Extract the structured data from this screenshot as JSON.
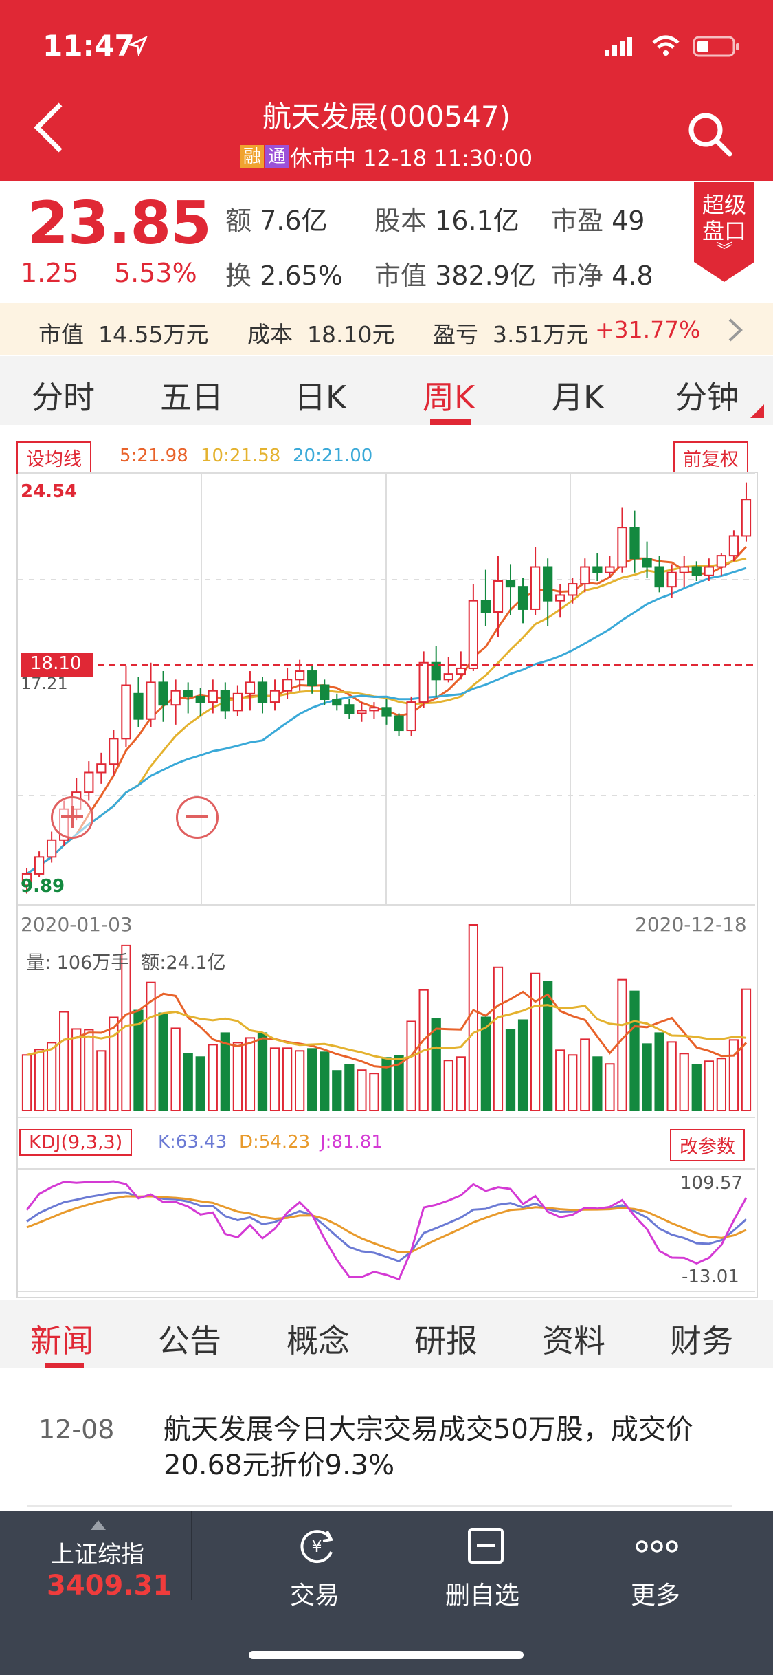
{
  "status": {
    "time": "11:47"
  },
  "header": {
    "title": "航天发展(000547)",
    "tag_rong": "融",
    "tag_tong": "通",
    "status_text": "休市中 12-18 11:30:00"
  },
  "quote": {
    "price": "23.85",
    "change": "1.25",
    "change_pct": "5.53%",
    "items": [
      {
        "k": "额",
        "v": "7.6亿"
      },
      {
        "k": "股本",
        "v": "16.1亿"
      },
      {
        "k": "市盈",
        "v": "49"
      },
      {
        "k": "换",
        "v": "2.65%"
      },
      {
        "k": "市值",
        "v": "382.9亿"
      },
      {
        "k": "市净",
        "v": "4.8"
      }
    ],
    "badge": "超级盘口"
  },
  "holdings": {
    "mv_label": "市值",
    "mv": "14.55万元",
    "cost_label": "成本",
    "cost": "18.10元",
    "pl_label": "盈亏",
    "pl": "3.51万元",
    "pl_pct": "+31.77%"
  },
  "period_tabs": [
    "分时",
    "五日",
    "日K",
    "周K",
    "月K",
    "分钟"
  ],
  "active_period": 3,
  "chart": {
    "ma_button": "设均线",
    "adj_button": "前复权",
    "ma5": "5:21.98",
    "ma10": "10:21.58",
    "ma20": "20:21.00",
    "high_label": "24.54",
    "low_label": "9.89",
    "cost_line_label": "18.10",
    "ref_label": "17.21",
    "date_start": "2020-01-03",
    "date_end": "2020-12-18",
    "vol_label": "量: 106万手",
    "amt_label": "额:24.1亿",
    "kdj_button": "KDJ(9,3,3)",
    "kdj_k": "K:63.43",
    "kdj_d": "D:54.23",
    "kdj_j": "J:81.81",
    "kdj_param_button": "改参数",
    "kdj_max": "109.57",
    "kdj_min": "-13.01",
    "colors": {
      "up": "#e02835",
      "down": "#13893f",
      "ma5": "#e8622a",
      "ma10": "#e4b22f",
      "ma20": "#3aa9d8",
      "k": "#6b7ad4",
      "d": "#e89a2c",
      "j": "#d43ad4"
    }
  },
  "chart_data": {
    "type": "candlestick",
    "price_range": [
      9.89,
      24.54
    ],
    "candles": [
      [
        10.2,
        10.6,
        9.9,
        10.8
      ],
      [
        10.6,
        11.2,
        10.5,
        11.4
      ],
      [
        11.2,
        11.8,
        11.0,
        12.1
      ],
      [
        11.8,
        12.9,
        11.6,
        13.2
      ],
      [
        12.9,
        13.5,
        12.5,
        14.0
      ],
      [
        13.5,
        14.2,
        13.2,
        14.6
      ],
      [
        14.2,
        14.5,
        13.8,
        14.9
      ],
      [
        14.5,
        15.4,
        14.1,
        15.7
      ],
      [
        15.4,
        17.3,
        15.1,
        18.0
      ],
      [
        17.0,
        16.1,
        15.8,
        17.6
      ],
      [
        16.1,
        17.4,
        15.8,
        18.1
      ],
      [
        17.4,
        16.6,
        16.0,
        17.8
      ],
      [
        16.6,
        17.1,
        15.9,
        17.5
      ],
      [
        17.1,
        16.9,
        16.3,
        17.4
      ],
      [
        16.9,
        16.7,
        16.2,
        17.2
      ],
      [
        16.7,
        17.1,
        16.3,
        17.5
      ],
      [
        17.1,
        16.4,
        16.1,
        17.4
      ],
      [
        16.4,
        17.0,
        16.2,
        17.3
      ],
      [
        17.0,
        17.4,
        16.4,
        17.8
      ],
      [
        17.4,
        16.7,
        16.3,
        17.6
      ],
      [
        16.7,
        17.1,
        16.4,
        17.5
      ],
      [
        17.1,
        17.5,
        16.8,
        17.9
      ],
      [
        17.5,
        17.8,
        17.1,
        18.2
      ],
      [
        17.8,
        17.3,
        17.0,
        18.0
      ],
      [
        17.3,
        16.8,
        16.6,
        17.5
      ],
      [
        16.8,
        16.6,
        16.4,
        17.0
      ],
      [
        16.6,
        16.3,
        16.1,
        16.8
      ],
      [
        16.3,
        16.4,
        16.0,
        16.7
      ],
      [
        16.4,
        16.5,
        16.1,
        16.7
      ],
      [
        16.5,
        16.2,
        15.9,
        16.8
      ],
      [
        16.2,
        15.7,
        15.5,
        16.3
      ],
      [
        15.7,
        16.7,
        15.5,
        16.9
      ],
      [
        16.7,
        18.1,
        16.5,
        18.5
      ],
      [
        18.1,
        17.5,
        16.9,
        18.7
      ],
      [
        17.5,
        17.7,
        17.4,
        18.3
      ],
      [
        17.7,
        17.9,
        17.5,
        18.5
      ],
      [
        17.9,
        20.3,
        17.8,
        20.9
      ],
      [
        20.3,
        19.9,
        19.4,
        21.4
      ],
      [
        19.9,
        21.0,
        19.0,
        21.9
      ],
      [
        21.0,
        20.8,
        19.8,
        21.6
      ],
      [
        20.8,
        20.0,
        19.5,
        21.1
      ],
      [
        20.0,
        21.5,
        19.8,
        22.2
      ],
      [
        21.5,
        20.3,
        19.4,
        21.8
      ],
      [
        20.3,
        20.5,
        19.7,
        20.9
      ],
      [
        20.5,
        20.9,
        20.2,
        21.1
      ],
      [
        20.9,
        21.5,
        20.6,
        21.8
      ],
      [
        21.5,
        21.3,
        21.0,
        22.0
      ],
      [
        21.3,
        21.5,
        21.1,
        21.9
      ],
      [
        21.5,
        22.9,
        21.3,
        23.6
      ],
      [
        22.9,
        21.8,
        21.3,
        23.5
      ],
      [
        21.8,
        21.5,
        21.1,
        22.4
      ],
      [
        21.5,
        20.8,
        20.6,
        21.9
      ],
      [
        20.8,
        21.3,
        20.4,
        21.6
      ],
      [
        21.3,
        21.5,
        20.8,
        21.9
      ],
      [
        21.5,
        21.2,
        21.0,
        21.7
      ],
      [
        21.2,
        21.5,
        21.0,
        21.8
      ],
      [
        21.5,
        21.9,
        21.2,
        22.0
      ],
      [
        21.9,
        22.6,
        21.7,
        22.8
      ],
      [
        22.6,
        23.9,
        22.4,
        24.5
      ]
    ]
  },
  "news_tabs": [
    "新闻",
    "公告",
    "概念",
    "研报",
    "资料",
    "财务"
  ],
  "active_news": 0,
  "news": [
    {
      "date": "12-08",
      "text": "航天发展今日大宗交易成交50万股，成交价20.68元折价9.3%"
    }
  ],
  "bottom": {
    "index_name": "上证综指",
    "index_value": "3409.31",
    "trade": "交易",
    "remove": "删自选",
    "more": "更多"
  }
}
